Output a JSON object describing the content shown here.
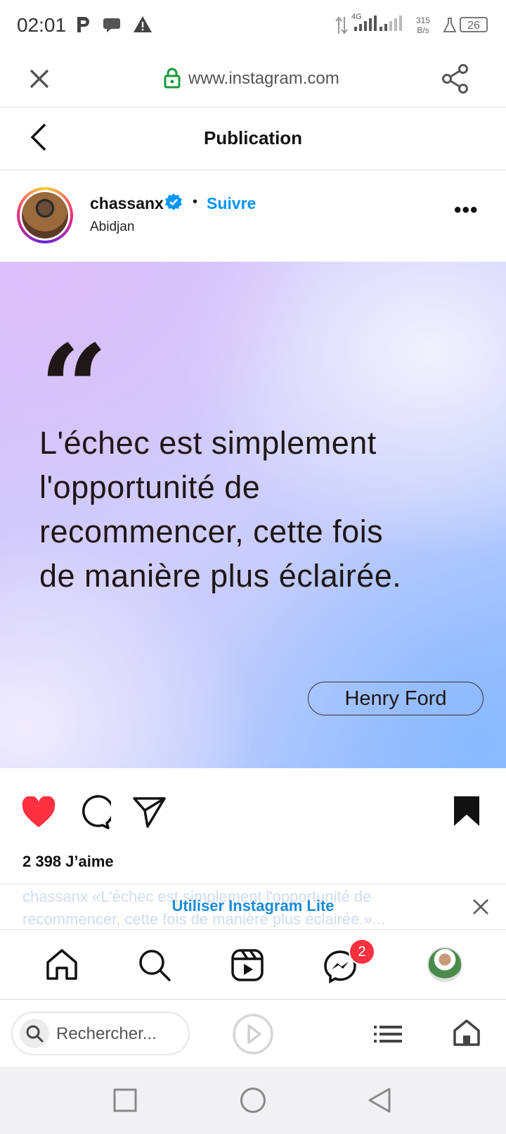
{
  "status_bar": {
    "time": "02:01",
    "network_type": "4G",
    "speed_value": "315",
    "speed_unit": "B/s",
    "battery": "26",
    "icons": [
      "p-app-icon",
      "chat-bubble-icon",
      "warning-icon",
      "data-arrows-icon",
      "signal-icon",
      "signal-icon",
      "flask-icon",
      "battery-icon"
    ]
  },
  "browser": {
    "url": "www.instagram.com",
    "icons": [
      "close-icon",
      "lock-icon",
      "share-icon"
    ]
  },
  "page": {
    "title": "Publication"
  },
  "post": {
    "username": "chassanx",
    "separator": "•",
    "follow_label": "Suivre",
    "location": "Abidjan",
    "more_label": "•••",
    "quote_mark": "“",
    "quote_lines": [
      "L'échec est simplement",
      "l'opportunité de",
      "recommencer, cette fois",
      "de manière plus éclairée."
    ],
    "author": "Henry Ford",
    "likes": "2 398 J’aime",
    "liked": true,
    "saved": true,
    "heart_color": "#ff3040"
  },
  "banner": {
    "ghost_caption_line1": "chassanx «L'échec est simplement l'opportunité de",
    "ghost_caption_line2": "recommencer, cette fois de manière plus éclairée.»...",
    "cta": "Utiliser Instagram Lite",
    "cta_color": "#1a8ad8"
  },
  "ig_nav": {
    "items": [
      "home-icon",
      "search-icon",
      "reels-icon",
      "messenger-icon",
      "profile-avatar"
    ],
    "messenger_badge": "2"
  },
  "browser_bottom": {
    "search_placeholder": "Rechercher...",
    "icons": [
      "search-icon",
      "play-icon",
      "list-icon",
      "home-icon"
    ]
  },
  "system_nav": {
    "icons": [
      "recents-square-icon",
      "home-circle-icon",
      "back-triangle-icon"
    ]
  },
  "colors": {
    "accent": "#0095f6",
    "verified": "#0095f6",
    "badge": "#ff3040"
  }
}
